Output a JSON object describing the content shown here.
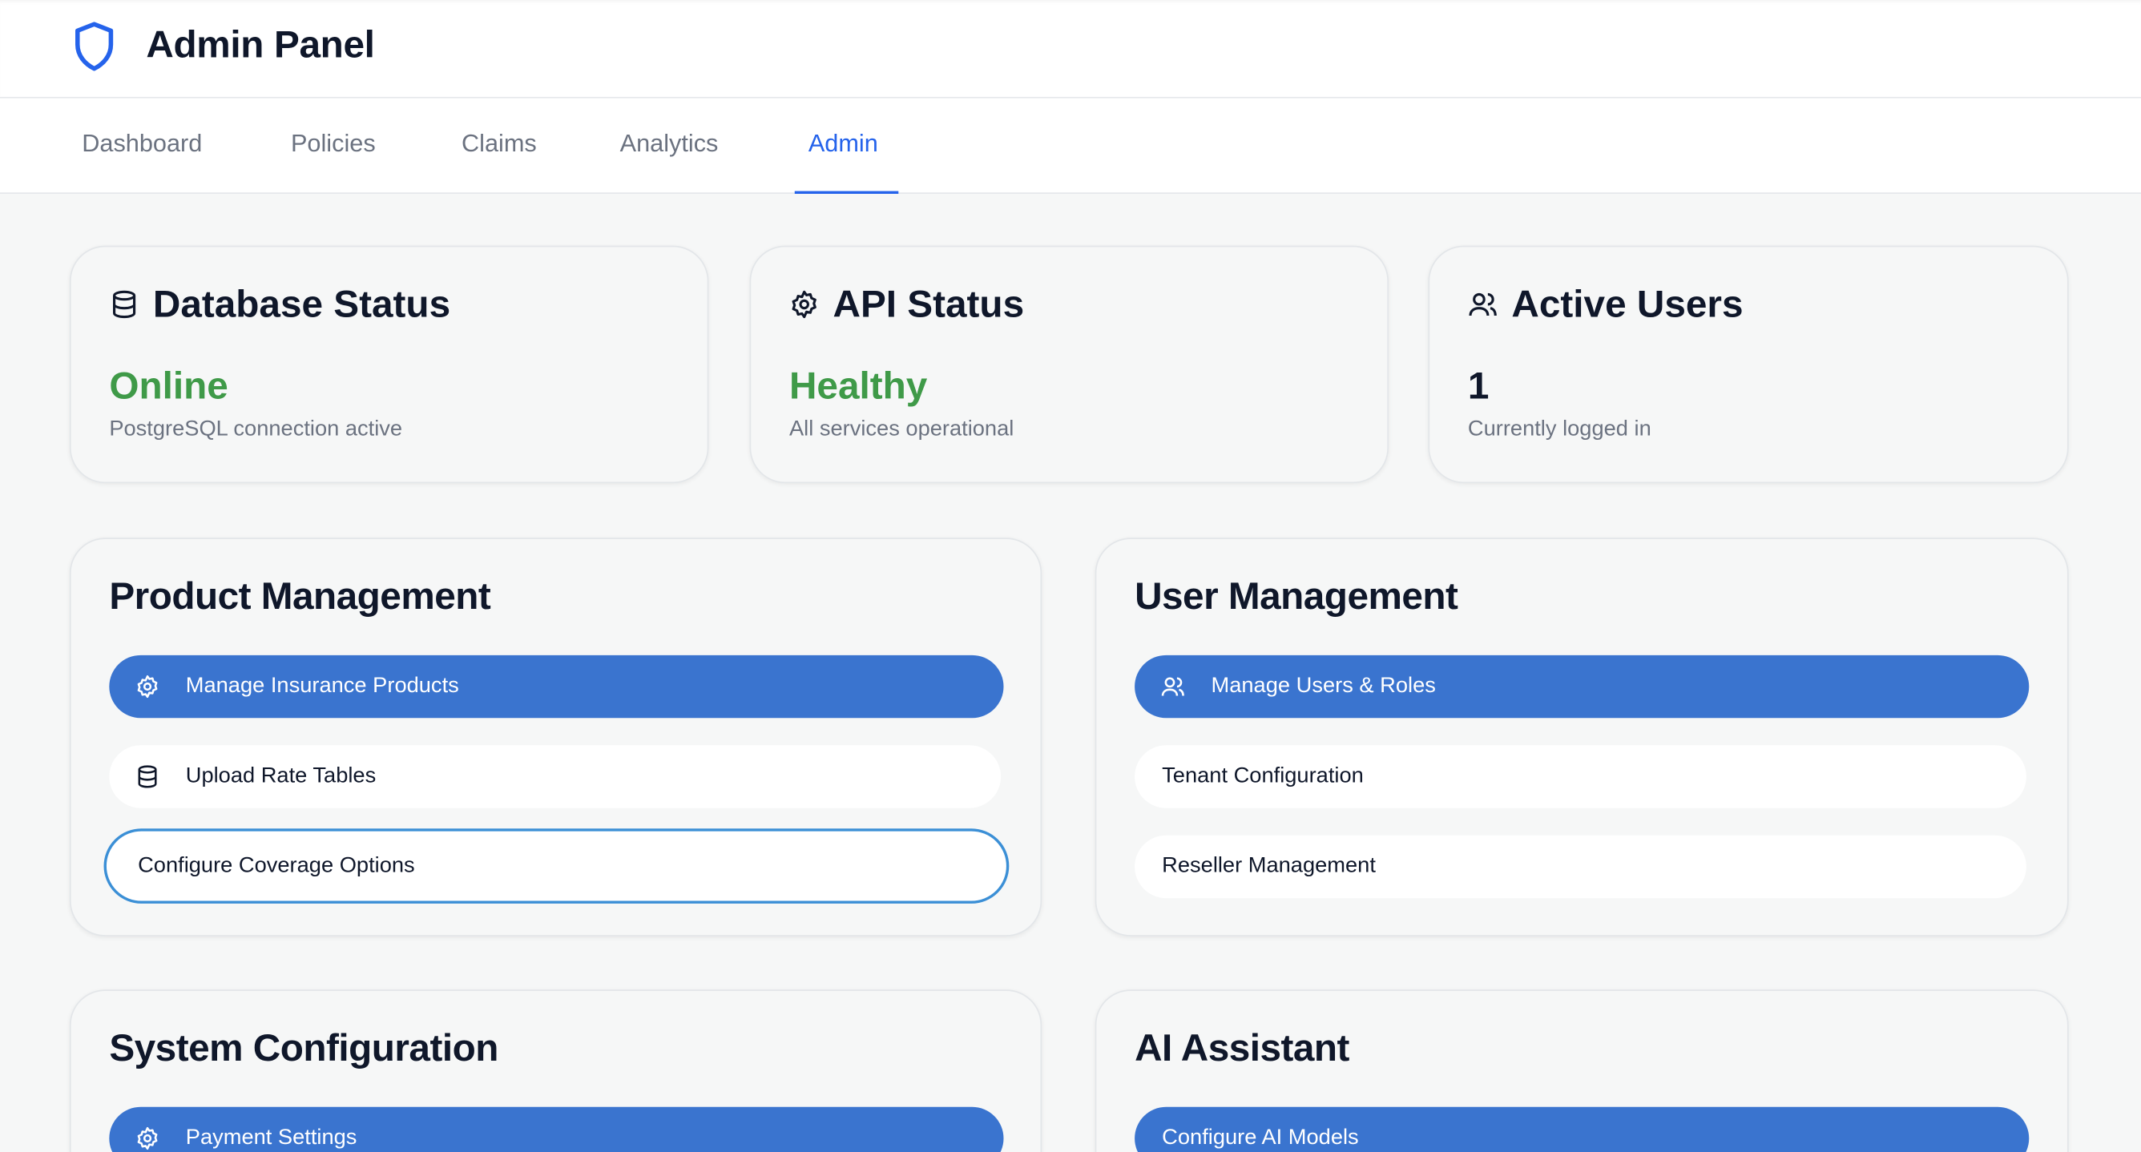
{
  "header": {
    "title": "Admin Panel",
    "logo_icon": "shield-icon",
    "accent": "#2563eb"
  },
  "tabs": [
    {
      "label": "Dashboard",
      "active": false
    },
    {
      "label": "Policies",
      "active": false
    },
    {
      "label": "Claims",
      "active": false
    },
    {
      "label": "Analytics",
      "active": false
    },
    {
      "label": "Admin",
      "active": true
    }
  ],
  "stats": [
    {
      "icon": "database-icon",
      "title": "Database Status",
      "value": "Online",
      "subtitle": "PostgreSQL connection active",
      "value_color": "#3f9a48"
    },
    {
      "icon": "gear-icon",
      "title": "API Status",
      "value": "Healthy",
      "subtitle": "All services operational",
      "value_color": "#3f9a48"
    },
    {
      "icon": "users-icon",
      "title": "Active Users",
      "value": "1",
      "subtitle": "Currently logged in",
      "value_color": "#0f172a"
    }
  ],
  "sections": {
    "product": {
      "title": "Product Management",
      "buttons": [
        {
          "label": "Manage Insurance Products",
          "icon": "gear-icon",
          "style": "primary"
        },
        {
          "label": "Upload Rate Tables",
          "icon": "database-icon",
          "style": "plain"
        },
        {
          "label": "Configure Coverage Options",
          "icon": null,
          "style": "focused"
        }
      ]
    },
    "user": {
      "title": "User Management",
      "buttons": [
        {
          "label": "Manage Users & Roles",
          "icon": "users-icon",
          "style": "primary"
        },
        {
          "label": "Tenant Configuration",
          "icon": null,
          "style": "plain"
        },
        {
          "label": "Reseller Management",
          "icon": null,
          "style": "plain"
        }
      ]
    },
    "system": {
      "title": "System Configuration",
      "buttons": [
        {
          "label": "Payment Settings",
          "icon": "gear-icon",
          "style": "primary"
        }
      ]
    },
    "ai": {
      "title": "AI Assistant",
      "buttons": [
        {
          "label": "Configure AI Models",
          "icon": null,
          "style": "primary"
        }
      ]
    }
  },
  "colors": {
    "primary_button": "#3a74cf",
    "status_green": "#3f9a48",
    "page_background": "#f6f7f7"
  }
}
